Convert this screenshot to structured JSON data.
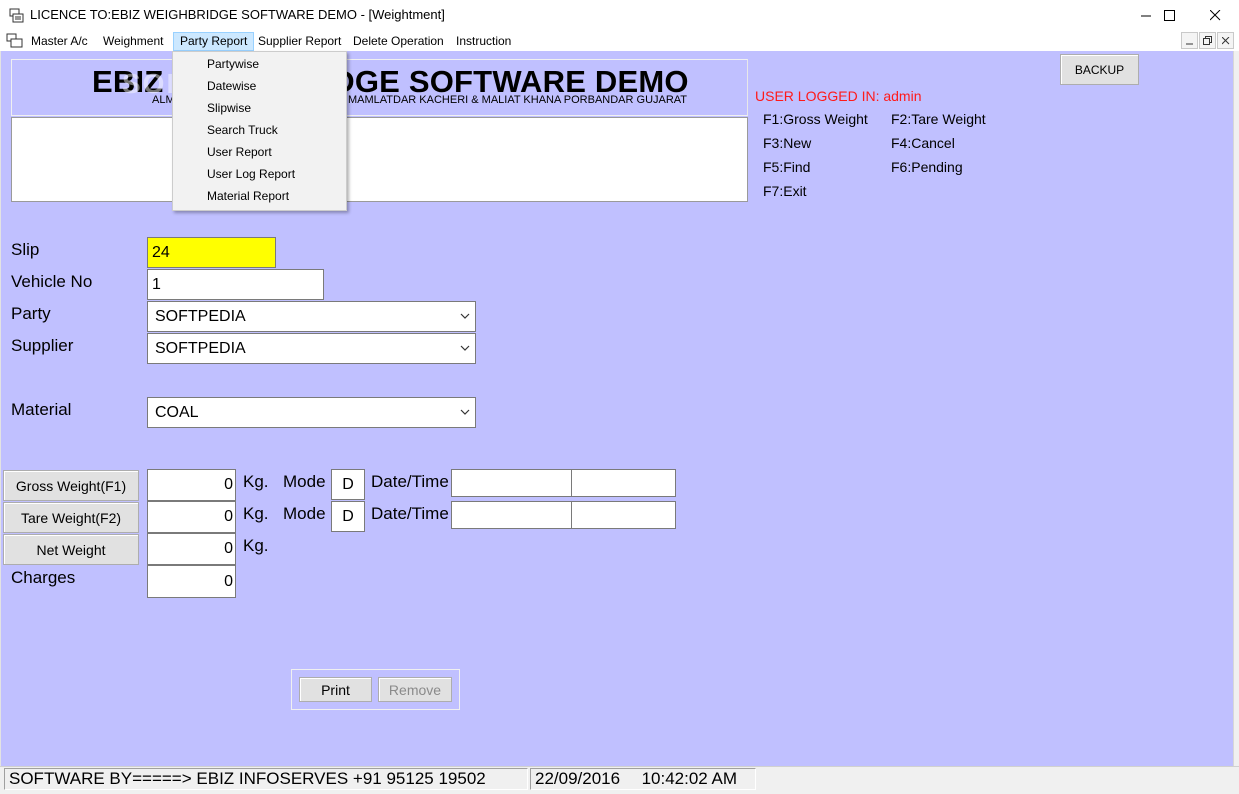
{
  "window": {
    "title": "LICENCE TO:EBIZ WEIGHBRIDGE SOFTWARE DEMO - [Weightment]",
    "minimize": "—",
    "maximize": "☐",
    "close": "✕"
  },
  "menubar": {
    "items": [
      {
        "label": "Master A/c"
      },
      {
        "label": "Weighment"
      },
      {
        "label": "Party Report"
      },
      {
        "label": "Supplier Report"
      },
      {
        "label": "Delete Operation"
      },
      {
        "label": "Instruction"
      }
    ],
    "active": "Party Report"
  },
  "party_report_menu": {
    "items": [
      "Partywise",
      "Datewise",
      "Slipwise",
      "Search Truck",
      "User Report",
      "User Log Report",
      "Material Report"
    ]
  },
  "header": {
    "company_name": "EBIZ WEIGHBRIDGE SOFTWARE DEMO",
    "address": "ALMAAL INDUSTRIES NEAR CHHAYA MAMLATDAR KACHERI & MALIAT KHANA PORBANDAR GUJARAT",
    "watermark": "SOFTPEDIA"
  },
  "backup_label": "BACKUP",
  "user_logged": "USER LOGGED IN: admin",
  "hotkeys": {
    "f1": "F1:Gross Weight",
    "f2": "F2:Tare Weight",
    "f3": "F3:New",
    "f4": "F4:Cancel",
    "f5": "F5:Find",
    "f6": "F6:Pending",
    "f7": "F7:Exit"
  },
  "form": {
    "slip_label": "Slip",
    "slip_value": "24",
    "vehicle_label": "Vehicle No",
    "vehicle_value": "1",
    "party_label": "Party",
    "party_value": "SOFTPEDIA",
    "supplier_label": "Supplier",
    "supplier_value": "SOFTPEDIA",
    "material_label": "Material",
    "material_value": "COAL",
    "gross_button": "Gross Weight(F1)",
    "gross_value": "0",
    "tare_button": "Tare Weight(F2)",
    "tare_value": "0",
    "net_button": "Net Weight",
    "net_value": "0",
    "charges_label": "Charges",
    "charges_value": "0",
    "unit": "Kg.",
    "mode_label": "Mode",
    "gross_mode": "D",
    "tare_mode": "D",
    "datetime_label": "Date/Time",
    "gross_date": "",
    "gross_time": "",
    "tare_date": "",
    "tare_time": ""
  },
  "buttons": {
    "print": "Print",
    "remove": "Remove"
  },
  "status": {
    "software_by": "SOFTWARE BY=====>  EBIZ INFOSERVES +91 95125 19502",
    "date": "22/09/2016",
    "time": "10:42:02 AM"
  },
  "colors": {
    "client_bg": "#c0c0ff",
    "slip_highlight": "#ffff00",
    "user_logged": "#ff1a1a",
    "menu_active": "#cce8ff"
  }
}
